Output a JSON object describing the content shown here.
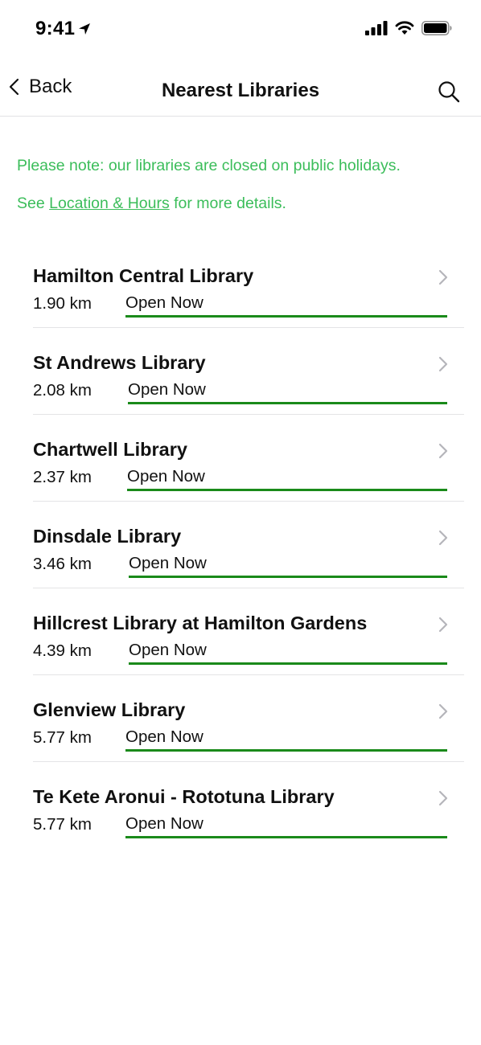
{
  "status_bar": {
    "time": "9:41"
  },
  "nav": {
    "back_label": "Back",
    "title": "Nearest Libraries"
  },
  "notice": {
    "line1": "Please note: our libraries are closed on public holidays.",
    "line2_prefix": "See ",
    "line2_link": "Location & Hours",
    "line2_suffix": " for more details."
  },
  "libraries": [
    {
      "name": "Hamilton Central Library",
      "distance": "1.90 km",
      "status": "Open Now"
    },
    {
      "name": "St Andrews Library",
      "distance": "2.08 km",
      "status": "Open Now"
    },
    {
      "name": "Chartwell Library",
      "distance": "2.37 km",
      "status": "Open Now"
    },
    {
      "name": "Dinsdale Library",
      "distance": "3.46 km",
      "status": "Open Now"
    },
    {
      "name": "Hillcrest Library at Hamilton Gardens",
      "distance": "4.39 km",
      "status": "Open Now"
    },
    {
      "name": "Glenview Library",
      "distance": "5.77 km",
      "status": "Open Now"
    },
    {
      "name": "Te Kete Aronui - Rototuna Library",
      "distance": "5.77 km",
      "status": "Open Now"
    }
  ],
  "colors": {
    "notice_green": "#3bbd5a",
    "status_underline": "#1a8a1a"
  }
}
